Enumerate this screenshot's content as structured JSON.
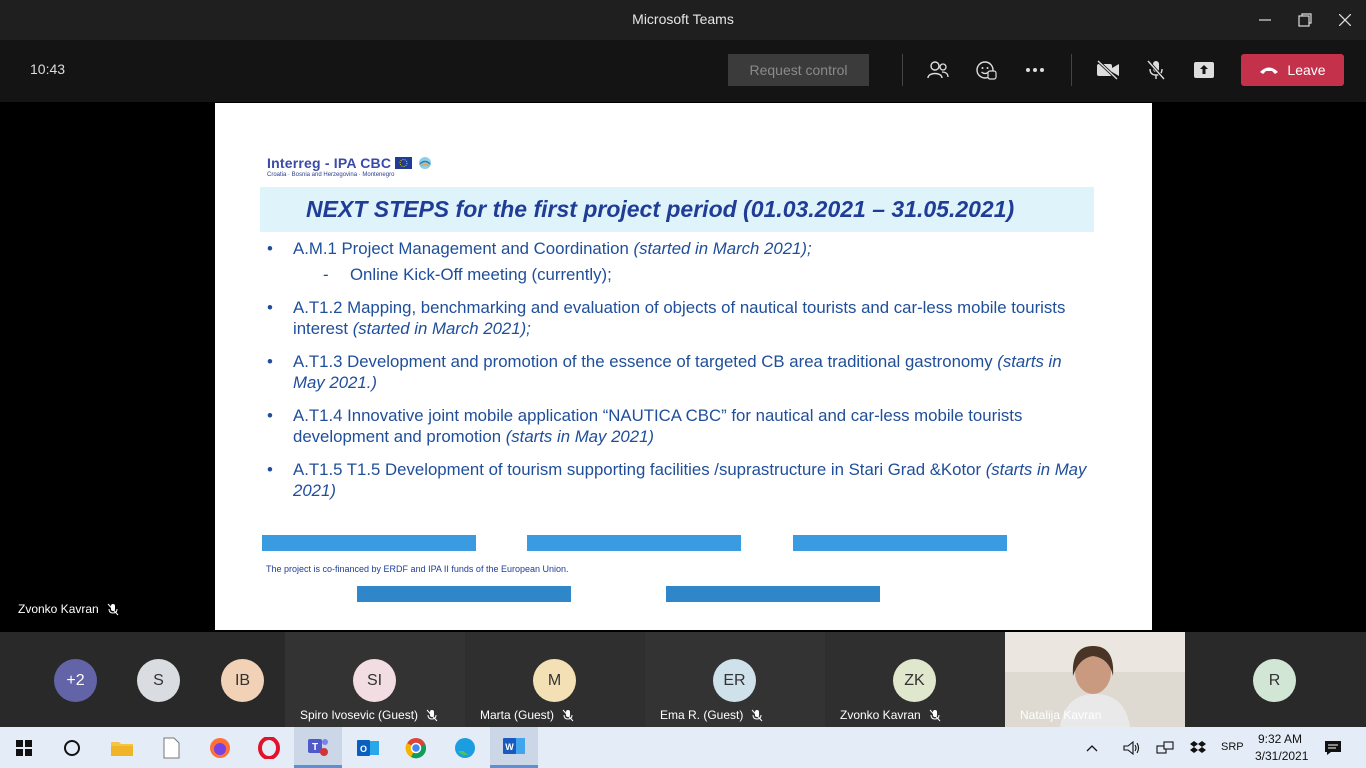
{
  "window": {
    "title": "Microsoft Teams",
    "minimize_icon": "minimize-icon",
    "restore_icon": "restore-icon",
    "close_icon": "close-icon"
  },
  "toolbar": {
    "timer": "10:43",
    "request_control_label": "Request control",
    "leave_label": "Leave",
    "leave_color": "#c4314b"
  },
  "stage": {
    "presenter_name": "Zvonko Kavran"
  },
  "slide": {
    "logo_text": "Interreg - IPA CBC",
    "logo_subtext": "Croatia · Bosnia and Herzegovina · Montenegro",
    "heading": "NEXT STEPS for the first project period (01.03.2021 – 31.05.2021)",
    "bullets": [
      {
        "text": "A.M.1 Project Management and Coordination ",
        "note": "(started in March 2021);"
      },
      {
        "text": "Online Kick-Off meeting (currently);"
      },
      {
        "text": "A.T1.2 Mapping, benchmarking and evaluation of objects of nautical tourists and car-less mobile tourists interest ",
        "note": "(started in March 2021);"
      },
      {
        "text": "A.T1.3 Development and promotion of the essence of targeted CB area traditional gastronomy ",
        "note": "(starts in May 2021.)"
      },
      {
        "text": "A.T1.4 Innovative joint mobile application “NAUTICA CBC” for nautical and car-less mobile tourists development and promotion ",
        "note": "(starts in May 2021)"
      },
      {
        "text": "A.T1.5 T1.5 Development of tourism supporting facilities /suprastructure in Stari Grad &Kotor ",
        "note": "(starts in May 2021)"
      }
    ],
    "cofinanced": "The project is co-financed by ERDF and IPA II funds of the European Union.",
    "heading_color": "#1f3d96",
    "text_color": "#1f4e9a"
  },
  "participants": [
    {
      "initials": "+2",
      "color": "#6264a7"
    },
    {
      "initials": "S",
      "color": "#d9dde2"
    },
    {
      "initials": "IB",
      "color": "#f1d2b6"
    },
    {
      "initials": "SI",
      "name": "Spiro Ivosevic (Guest)",
      "color": "#f1dde2"
    },
    {
      "initials": "M",
      "name": "Marta (Guest)",
      "color": "#f3e1b5"
    },
    {
      "initials": "ER",
      "name": "Ema R. (Guest)",
      "color": "#cfe2ec"
    },
    {
      "initials": "ZK",
      "name": "Zvonko Kavran",
      "color": "#dfe8cc"
    },
    {
      "name": "Natalija Kavran"
    },
    {
      "initials": "R",
      "color": "#d2e6d6"
    }
  ],
  "taskbar": {
    "language": "SRP",
    "time": "9:32 AM",
    "date": "3/31/2021"
  }
}
